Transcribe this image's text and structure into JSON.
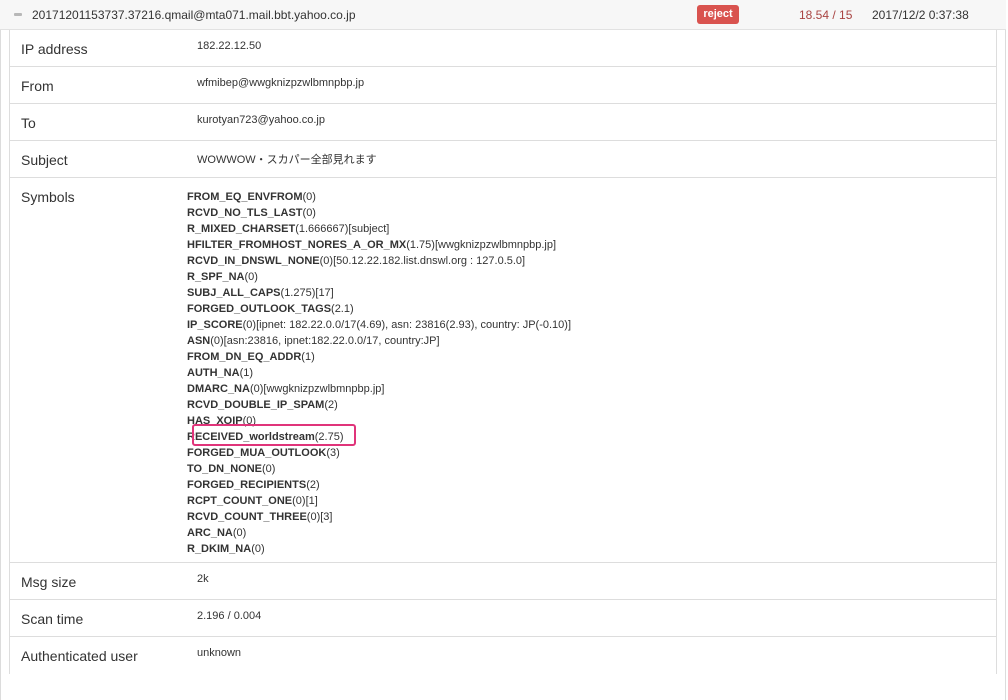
{
  "message": {
    "id": "20171201153737.37216.qmail@mta071.mail.bbt.yahoo.co.jp",
    "action": "reject",
    "score": "18.54 / 15",
    "time": "2017/12/2 0:37:38"
  },
  "details": {
    "ip": {
      "label": "IP address",
      "value": "182.22.12.50"
    },
    "from": {
      "label": "From",
      "value": "wfmibep@wwgknizpzwlbmnpbp.jp"
    },
    "to": {
      "label": "To",
      "value": "kurotyan723@yahoo.co.jp"
    },
    "subject": {
      "label": "Subject",
      "value": "WOWWOW・スカパー全部見れます"
    },
    "symbols_label": "Symbols",
    "msg_size": {
      "label": "Msg size",
      "value": "2k"
    },
    "scan_time": {
      "label": "Scan time",
      "value": "2.196 / 0.004"
    },
    "auth_user": {
      "label": "Authenticated user",
      "value": "unknown"
    }
  },
  "symbols": [
    {
      "name": "FROM_EQ_ENVFROM",
      "detail": "(0)"
    },
    {
      "name": "RCVD_NO_TLS_LAST",
      "detail": "(0)"
    },
    {
      "name": "R_MIXED_CHARSET",
      "detail": "(1.666667)[subject]"
    },
    {
      "name": "HFILTER_FROMHOST_NORES_A_OR_MX",
      "detail": "(1.75)[wwgknizpzwlbmnpbp.jp]"
    },
    {
      "name": "RCVD_IN_DNSWL_NONE",
      "detail": "(0)[50.12.22.182.list.dnswl.org : 127.0.5.0]"
    },
    {
      "name": "R_SPF_NA",
      "detail": "(0)"
    },
    {
      "name": "SUBJ_ALL_CAPS",
      "detail": "(1.275)[17]"
    },
    {
      "name": "FORGED_OUTLOOK_TAGS",
      "detail": "(2.1)"
    },
    {
      "name": "IP_SCORE",
      "detail": "(0)[ipnet: 182.22.0.0/17(4.69), asn: 23816(2.93), country: JP(-0.10)]"
    },
    {
      "name": "ASN",
      "detail": "(0)[asn:23816, ipnet:182.22.0.0/17, country:JP]"
    },
    {
      "name": "FROM_DN_EQ_ADDR",
      "detail": "(1)"
    },
    {
      "name": "AUTH_NA",
      "detail": "(1)"
    },
    {
      "name": "DMARC_NA",
      "detail": "(0)[wwgknizpzwlbmnpbp.jp]"
    },
    {
      "name": "RCVD_DOUBLE_IP_SPAM",
      "detail": "(2)"
    },
    {
      "name": "HAS_XOIP",
      "detail": "(0)"
    },
    {
      "name": "RECEIVED_worldstream",
      "detail": "(2.75)"
    },
    {
      "name": "FORGED_MUA_OUTLOOK",
      "detail": "(3)"
    },
    {
      "name": "TO_DN_NONE",
      "detail": "(0)"
    },
    {
      "name": "FORGED_RECIPIENTS",
      "detail": "(2)"
    },
    {
      "name": "RCPT_COUNT_ONE",
      "detail": "(0)[1]"
    },
    {
      "name": "RCVD_COUNT_THREE",
      "detail": "(0)[3]"
    },
    {
      "name": "ARC_NA",
      "detail": "(0)"
    },
    {
      "name": "R_DKIM_NA",
      "detail": "(0)"
    }
  ],
  "colors": {
    "reject_badge": "#d9534f",
    "score_text": "#a94442",
    "highlight": "#e0347a"
  }
}
